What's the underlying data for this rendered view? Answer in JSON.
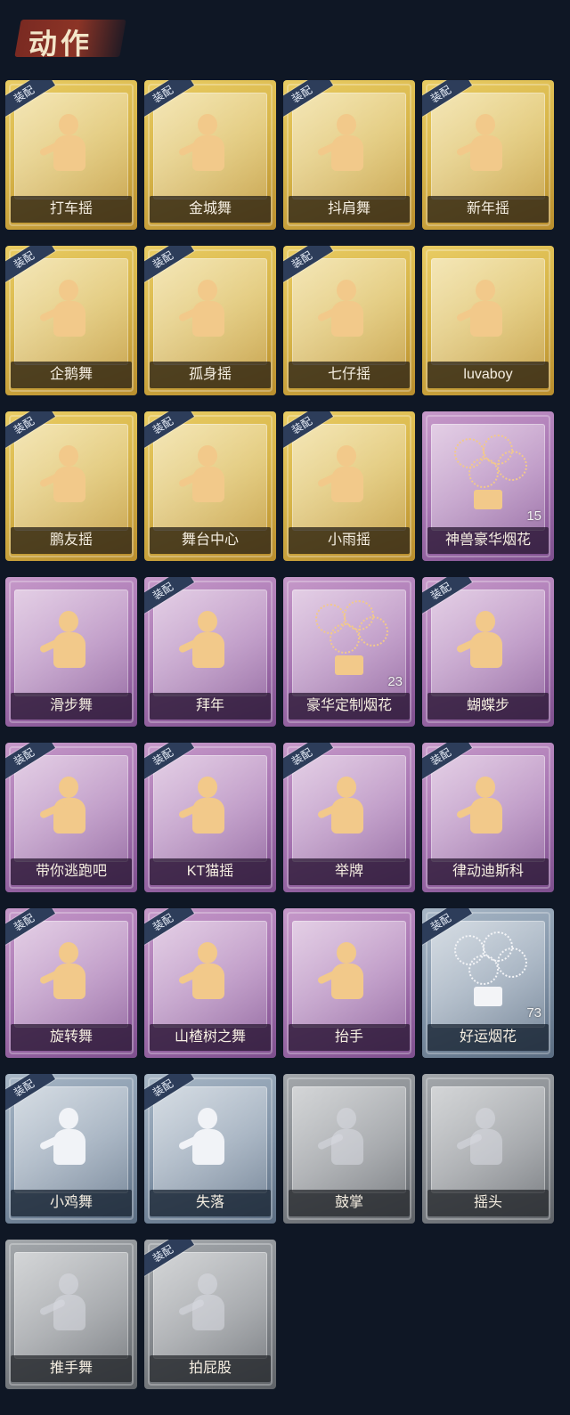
{
  "header": {
    "title": "动作"
  },
  "equipped_label": "装配",
  "cards": [
    {
      "label": "打车摇",
      "tier": "gold",
      "equipped": true,
      "icon": "dance-figure-icon",
      "count": null
    },
    {
      "label": "金城舞",
      "tier": "gold",
      "equipped": true,
      "icon": "dance-figure-icon",
      "count": null
    },
    {
      "label": "抖肩舞",
      "tier": "gold",
      "equipped": true,
      "icon": "dance-figure-icon",
      "count": null
    },
    {
      "label": "新年摇",
      "tier": "gold",
      "equipped": true,
      "icon": "dance-figure-icon",
      "count": null
    },
    {
      "label": "企鹅舞",
      "tier": "gold",
      "equipped": true,
      "icon": "dance-figure-icon",
      "count": null
    },
    {
      "label": "孤身摇",
      "tier": "gold",
      "equipped": true,
      "icon": "dance-figure-icon",
      "count": null
    },
    {
      "label": "七仔摇",
      "tier": "gold",
      "equipped": true,
      "icon": "dance-figure-icon",
      "count": null
    },
    {
      "label": "luvaboy",
      "tier": "gold",
      "equipped": false,
      "icon": "dance-figure-icon",
      "count": null
    },
    {
      "label": "鹏友摇",
      "tier": "gold",
      "equipped": true,
      "icon": "dance-figure-icon",
      "count": null
    },
    {
      "label": "舞台中心",
      "tier": "gold",
      "equipped": true,
      "icon": "dance-figure-icon",
      "count": null
    },
    {
      "label": "小雨摇",
      "tier": "gold",
      "equipped": true,
      "icon": "dance-figure-icon",
      "count": null
    },
    {
      "label": "神兽豪华烟花",
      "tier": "purple",
      "equipped": false,
      "icon": "fireworks-icon",
      "count": "15"
    },
    {
      "label": "滑步舞",
      "tier": "purple",
      "equipped": false,
      "icon": "dance-figure-icon",
      "count": null
    },
    {
      "label": "拜年",
      "tier": "purple",
      "equipped": true,
      "icon": "bow-figure-icon",
      "count": null
    },
    {
      "label": "豪华定制烟花",
      "tier": "purple",
      "equipped": false,
      "icon": "fireworks-icon",
      "count": "23"
    },
    {
      "label": "蝴蝶步",
      "tier": "purple",
      "equipped": true,
      "icon": "dance-figure-icon",
      "count": null
    },
    {
      "label": "带你逃跑吧",
      "tier": "purple",
      "equipped": true,
      "icon": "dance-figure-icon",
      "count": null
    },
    {
      "label": "KT猫摇",
      "tier": "purple",
      "equipped": true,
      "icon": "dance-figure-icon",
      "count": null
    },
    {
      "label": "举牌",
      "tier": "purple",
      "equipped": true,
      "icon": "sign-figure-icon",
      "count": null
    },
    {
      "label": "律动迪斯科",
      "tier": "purple",
      "equipped": true,
      "icon": "dance-figure-icon",
      "count": null
    },
    {
      "label": "旋转舞",
      "tier": "purple",
      "equipped": true,
      "icon": "spin-figure-icon",
      "count": null
    },
    {
      "label": "山楂树之舞",
      "tier": "purple",
      "equipped": true,
      "icon": "dance-figure-icon",
      "count": null
    },
    {
      "label": "抬手",
      "tier": "purple",
      "equipped": false,
      "icon": "raise-hand-icon",
      "count": null
    },
    {
      "label": "好运烟花",
      "tier": "blue",
      "equipped": true,
      "icon": "fireworks-icon",
      "count": "73"
    },
    {
      "label": "小鸡舞",
      "tier": "blue",
      "equipped": true,
      "icon": "dance-figure-icon",
      "count": null
    },
    {
      "label": "失落",
      "tier": "blue",
      "equipped": true,
      "icon": "crawl-figure-icon",
      "count": null
    },
    {
      "label": "鼓掌",
      "tier": "grey",
      "equipped": false,
      "icon": "clap-icon",
      "count": null
    },
    {
      "label": "摇头",
      "tier": "grey",
      "equipped": false,
      "icon": "dance-figure-icon",
      "count": null
    },
    {
      "label": "推手舞",
      "tier": "grey",
      "equipped": false,
      "icon": "dance-figure-icon",
      "count": null
    },
    {
      "label": "拍屁股",
      "tier": "grey",
      "equipped": true,
      "icon": "dance-figure-icon",
      "count": null
    }
  ]
}
